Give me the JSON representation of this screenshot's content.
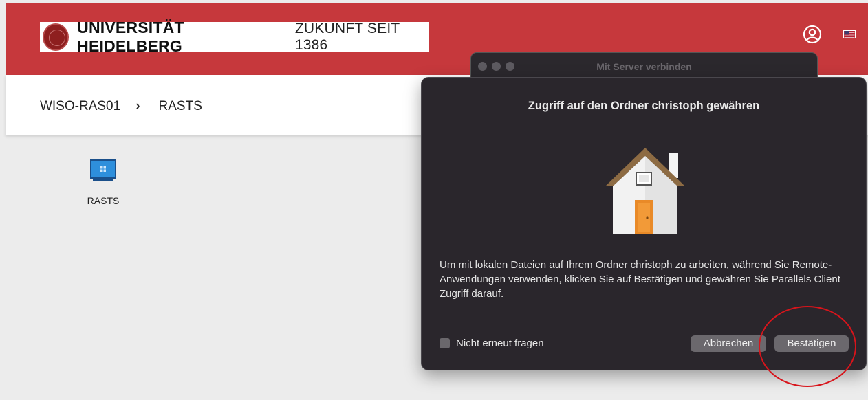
{
  "header": {
    "university_name": "UNIVERSITÄT HEIDELBERG",
    "tagline": "ZUKUNFT SEIT 1386",
    "colors": {
      "brand_red": "#c6383c"
    },
    "icons": [
      "user-circle-icon",
      "us-flag-icon"
    ]
  },
  "breadcrumb": {
    "items": [
      "WISO-RAS01",
      "RASTS"
    ],
    "separator": "›"
  },
  "desktop": {
    "tiles": [
      {
        "label": "RASTS",
        "icon": "windows-monitor-icon"
      }
    ]
  },
  "background_window": {
    "title": "Mit Server verbinden"
  },
  "dialog": {
    "title": "Zugriff auf den Ordner christoph gewähren",
    "icon": "home-folder-icon",
    "message": "Um mit lokalen Dateien auf Ihrem Ordner christoph zu arbeiten, während Sie Remote-Anwendungen verwenden, klicken Sie auf Bestätigen und gewähren Sie Parallels Client Zugriff darauf.",
    "checkbox_label": "Nicht erneut fragen",
    "checkbox_checked": false,
    "cancel_label": "Abbrechen",
    "confirm_label": "Bestätigen"
  },
  "annotation": {
    "color": "#d8141b",
    "shape": "ellipse-around-confirm-button"
  }
}
